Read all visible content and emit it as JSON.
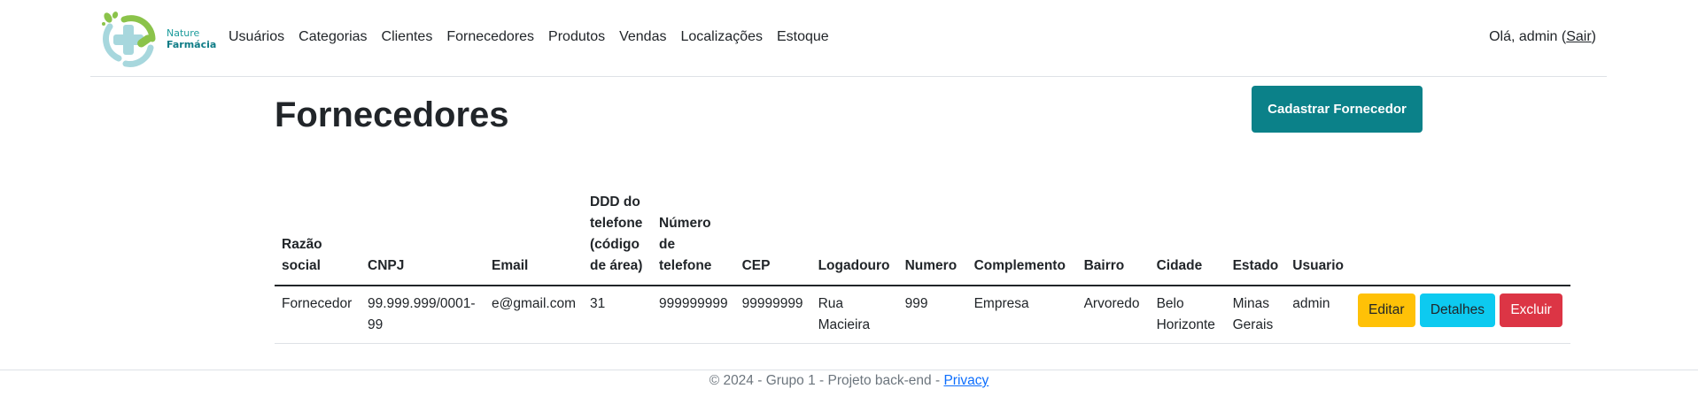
{
  "brand": {
    "line1": "Nature",
    "line2": "Farmácia",
    "colors": {
      "green": "#8bc34a",
      "teal": "#0e7c86",
      "light_teal": "#a7d7dd"
    }
  },
  "nav": {
    "items": [
      {
        "label": "Usuários"
      },
      {
        "label": "Categorias"
      },
      {
        "label": "Clientes"
      },
      {
        "label": "Fornecedores"
      },
      {
        "label": "Produtos"
      },
      {
        "label": "Vendas"
      },
      {
        "label": "Localizações"
      },
      {
        "label": "Estoque"
      }
    ],
    "greeting": "Olá, admin (",
    "logout": "Sair",
    "greeting_end": ")"
  },
  "page": {
    "title": "Fornecedores",
    "create_button": "Cadastrar Fornecedor",
    "create_button_color": "#0b8189"
  },
  "table": {
    "headers": [
      "Razão social",
      "CNPJ",
      "Email",
      "DDD do telefone (código de área)",
      "Número de telefone",
      "CEP",
      "Logadouro",
      "Numero",
      "Complemento",
      "Bairro",
      "Cidade",
      "Estado",
      "Usuario"
    ],
    "rows": [
      {
        "razao_social": "Fornecedor",
        "cnpj": "99.999.999/0001-99",
        "email": "e@gmail.com",
        "ddd": "31",
        "telefone": "999999999",
        "cep": "99999999",
        "logadouro": "Rua Macieira",
        "numero": "999",
        "complemento": "Empresa",
        "bairro": "Arvoredo",
        "cidade": "Belo Horizonte",
        "estado": "Minas Gerais",
        "usuario": "admin",
        "actions": {
          "edit": "Editar",
          "details": "Detalhes",
          "delete": "Excluir"
        }
      }
    ],
    "action_colors": {
      "edit": "#ffc107",
      "details": "#0dcaf0",
      "delete": "#dc3545"
    }
  },
  "footer": {
    "text": "© 2024 - Grupo 1 - Projeto back-end - ",
    "privacy": "Privacy"
  }
}
